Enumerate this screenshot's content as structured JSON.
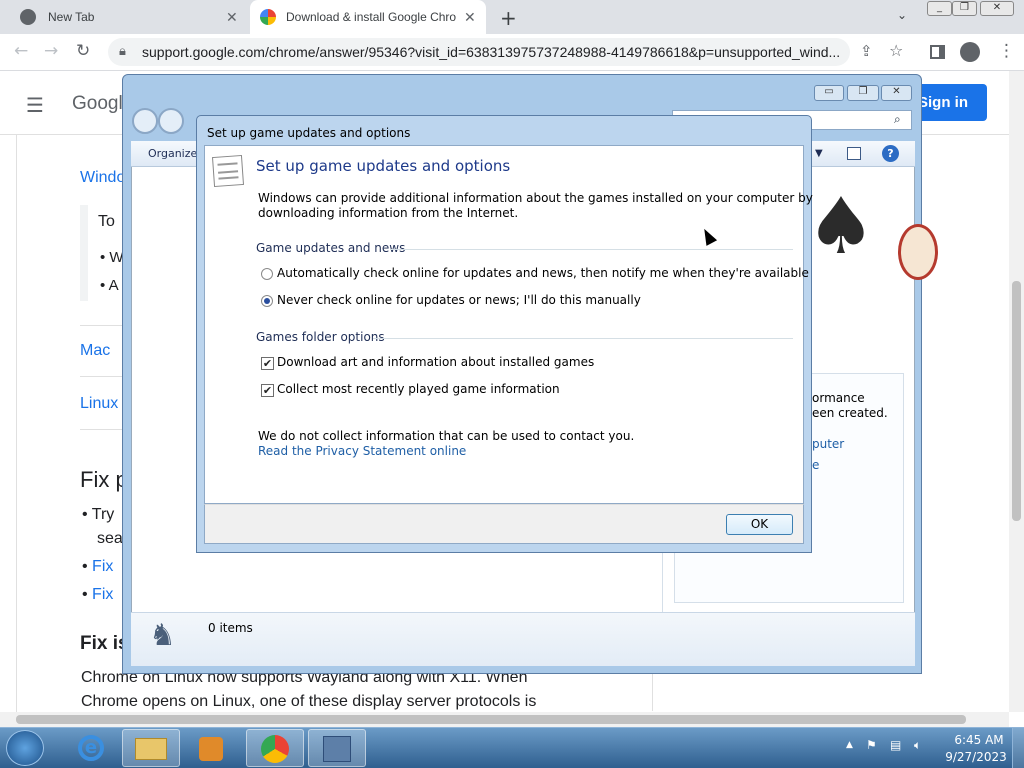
{
  "browser": {
    "tabs": [
      {
        "title": "New Tab",
        "active": false
      },
      {
        "title": "Download & install Google Chro",
        "active": true
      }
    ],
    "address": "support.google.com/chrome/answer/95346?visit_id=638313975737248988-4149786618&p=unsupported_wind...",
    "new_tab_symbol": "+"
  },
  "page": {
    "header_brand": "Googl",
    "sign_in": "Sign in",
    "side_links": [
      "Windo",
      "Mac",
      "Linux"
    ],
    "box_intro": "To",
    "box_bullets": [
      "W",
      "A"
    ],
    "fix_heading": "Fix p",
    "fix_bullets": [
      "Try",
      "sea"
    ],
    "fix_links": [
      "Fix",
      "Fix"
    ],
    "fix_heading2": "Fix is",
    "body_line1": "Chrome on Linux now supports Wayland along with X11. When",
    "body_line2": "Chrome opens on Linux, one of these display server protocols is"
  },
  "games_window": {
    "toolbar_organize": "Organize",
    "items_count": "0 items",
    "side_text_1": "ormance",
    "side_text_2": "een created.",
    "side_link_1": "puter",
    "side_link_2": "e"
  },
  "dialog": {
    "titlebar": "Set up game updates and options",
    "heading": "Set up game updates and options",
    "intro_line1": "Windows can provide additional information about the games installed on your computer by",
    "intro_line2": "downloading information from the Internet.",
    "section_updates": "Game updates and news",
    "radio_auto": "Automatically check online for updates and news, then notify me when they're available",
    "radio_never": "Never check online for updates or news; I'll do this manually",
    "radio_selected": "never",
    "section_folder": "Games folder options",
    "check_art": "Download art and information about installed games",
    "check_art_checked": true,
    "check_recent": "Collect most recently played game information",
    "check_recent_checked": true,
    "privacy_note": "We do not collect information that can be used to contact you.",
    "privacy_link": "Read the Privacy Statement online",
    "ok_label": "OK"
  },
  "taskbar": {
    "time": "6:45 AM",
    "date": "9/27/2023"
  },
  "colors": {
    "link_blue": "#1a73e8",
    "dialog_heading": "#1e3a8a",
    "win7_link": "#1f5fa6",
    "signin_blue": "#1a73e8"
  }
}
